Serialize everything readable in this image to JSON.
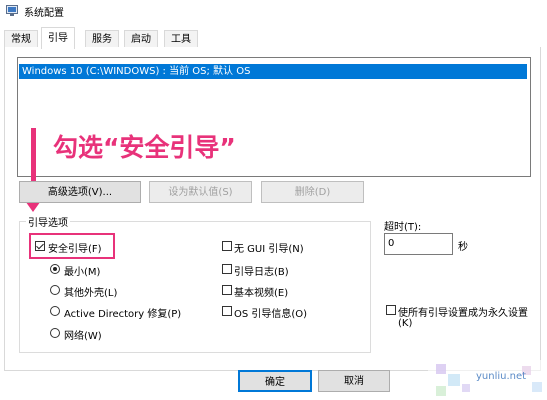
{
  "window": {
    "title": "系统配置",
    "icon": "msconfig-icon"
  },
  "tabs": [
    {
      "label": "常规"
    },
    {
      "label": "引导",
      "active": true
    },
    {
      "label": "服务"
    },
    {
      "label": "启动"
    },
    {
      "label": "工具"
    }
  ],
  "boot_list": {
    "selected": "Windows 10 (C:\\WINDOWS) : 当前 OS; 默认 OS"
  },
  "annotation": {
    "text": "勾选“安全引导”",
    "color": "#e8327a"
  },
  "buttons": {
    "advanced": "高级选项(V)...",
    "set_default": "设为默认值(S)",
    "delete": "删除(D)",
    "ok": "确定",
    "cancel": "取消"
  },
  "boot_options": {
    "group_label": "引导选项",
    "safe_boot": {
      "label": "安全引导(F)",
      "checked": true
    },
    "minimal": {
      "label": "最小(M)",
      "selected": true
    },
    "alternate_shell": {
      "label": "其他外壳(L)"
    },
    "ad_repair": {
      "label": "Active Directory 修复(P)"
    },
    "network": {
      "label": "网络(W)"
    },
    "no_gui": {
      "label": "无 GUI 引导(N)"
    },
    "boot_log": {
      "label": "引导日志(B)"
    },
    "base_video": {
      "label": "基本视频(E)"
    },
    "os_boot_info": {
      "label": "OS 引导信息(O)"
    }
  },
  "timeout": {
    "label": "超时(T):",
    "value": "0",
    "unit": "秒"
  },
  "make_permanent": {
    "label_line1": "使所有引导设置成为永久设置",
    "label_line2": "(K)"
  },
  "watermark": {
    "text": "yunliu.net"
  },
  "colors": {
    "accent": "#0078d7",
    "annotation": "#e8327a"
  }
}
